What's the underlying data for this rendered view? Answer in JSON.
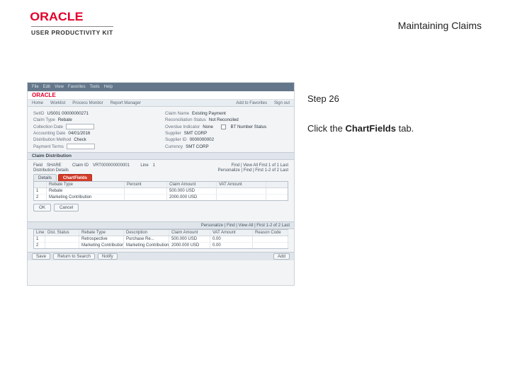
{
  "header": {
    "brand": "ORACLE",
    "brand_sub": "USER PRODUCTIVITY KIT",
    "title": "Maintaining Claims"
  },
  "instruction": {
    "step_label": "Step 26",
    "pre": "Click the ",
    "bold": "ChartFields",
    "post": " tab."
  },
  "thumb": {
    "oracle_mini": "ORACLE",
    "menubar": [
      "File",
      "Edit",
      "View",
      "Favorites",
      "Tools",
      "Help"
    ],
    "minorbar": [
      "Home",
      "Worklist",
      "Process Monitor",
      "Report Manager",
      "Add to Favorites",
      "Sign out"
    ],
    "form": {
      "l1_lab": "SetID",
      "l1_val": "US001 00000000271",
      "r1_lab": "Claim Name",
      "r1_val": "Existing Payment",
      "l2_lab": "Claim Type",
      "l2_val": "Rebate",
      "r2_lab": "Reconciliation Status",
      "r2_val": "Not Reconciled",
      "l3_lab": "Collection Date",
      "r3_lab": "Overdue Indicator",
      "r3_val": "None",
      "r3b_lab": "",
      "r3b_val": "BT Number Status",
      "l4_lab": "Accounting Date",
      "l4_val": "04/01/2016",
      "r4_lab": "Supplier",
      "r4_val": "SMT CORP",
      "l5_lab": "Distribution Method",
      "l5_val": "Check",
      "r5_lab": "Supplier ID",
      "r5_val": "0000000002",
      "l6_lab": "Payment Terms",
      "l6_val": "",
      "r6_lab": "Currency",
      "r6_val": "SMT CORP"
    },
    "sect1": "Claim Distribution",
    "sub1_lab1": "Field",
    "sub1_val1": "SHARE",
    "sub1_lab2": "Claim ID",
    "sub1_val2": "VRT000000000001",
    "sub1_lab3": "Line",
    "sub1_val3": "1",
    "sub1_ctrl": "Find | View All   First  1 of 1  Last",
    "sub2_lab": "Distribution Details",
    "sub2_ctrl": "Personalize | Find |   First  1-2 of 2  Last",
    "tabs": {
      "details": "Details",
      "chartfields": "ChartFields"
    },
    "grid1": {
      "h1": "",
      "h2": "Rebate Type",
      "h3": "Percent",
      "h4": "Claim Amount",
      "h5": "VAT Amount",
      "r1c1": "1",
      "r1c2": "Rebate",
      "r1c3": "",
      "r1c4": "500.000 USD",
      "r1c5": "",
      "r2c1": "2",
      "r2c2": "Marketing Contribution",
      "r2c3": "",
      "r2c4": "2000.000 USD",
      "r2c5": ""
    },
    "btns": {
      "ok": "OK",
      "cancel": "Cancel"
    },
    "lower_right": "Personalize | Find | View All |   First  1-2 of 2  Last",
    "grid2": {
      "h1": "Line",
      "h2": "Dist. Status",
      "h3": "Rebate Type",
      "h4": "Description",
      "h5": "Claim Amount",
      "h6": "VAT Amount",
      "h7": "Reason Code",
      "r1c1": "1",
      "r1c2": "",
      "r1c3": "Retrospective",
      "r1c4": "Purchase Re...",
      "r1c5": "500.000 USD",
      "r1c6": "0.00",
      "r1c7": "",
      "r2c1": "2",
      "r2c2": "",
      "r2c3": "Marketing Contribution",
      "r2c4": "Marketing Contribution",
      "r2c5": "2000.000 USD",
      "r2c6": "0.00",
      "r2c7": ""
    },
    "footer": {
      "save": "Save",
      "return": "Return to Search",
      "notify": "Notify",
      "add": "Add"
    }
  }
}
